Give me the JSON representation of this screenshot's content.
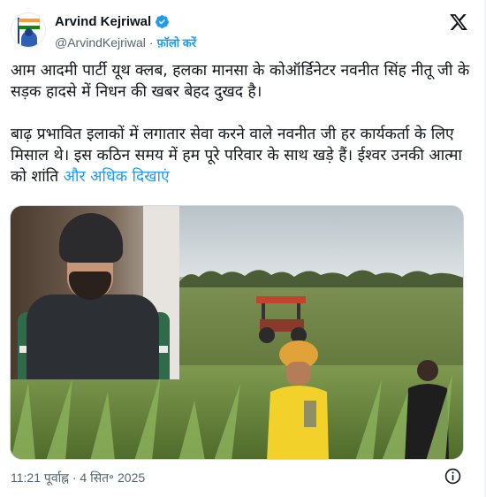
{
  "author": {
    "name": "Arvind Kejriwal",
    "handle": "@ArvindKejriwal",
    "separator": "·",
    "follow_label": "फ़ॉलो करें"
  },
  "icons": {
    "verified": "verified-badge-icon",
    "platform_logo": "x-logo-icon",
    "info": "info-icon"
  },
  "tweet": {
    "paragraph1": "आम आदमी पार्टी यूथ क्लब, हलका मानसा के कोऑर्डिनेटर नवनीत सिंह नीतू जी के सड़क हादसे में निधन की खबर बेहद दुखद है।",
    "paragraph2": "बाढ़ प्रभावित इलाकों में लगातार सेवा करने वाले नवनीत जी हर कार्यकर्ता के लिए मिसाल थे। इस कठिन समय में हम पूरे परिवार के साथ खड़े हैं। ईश्वर उनकी आत्मा को शांति",
    "show_more_label": "और अधिक दिखाएं"
  },
  "footer": {
    "timestamp": "11:21 पूर्वाह्न · 4 सित॰ 2025"
  },
  "colors": {
    "accent": "#1d9bf0",
    "text": "#0f1419",
    "muted": "#536471"
  }
}
